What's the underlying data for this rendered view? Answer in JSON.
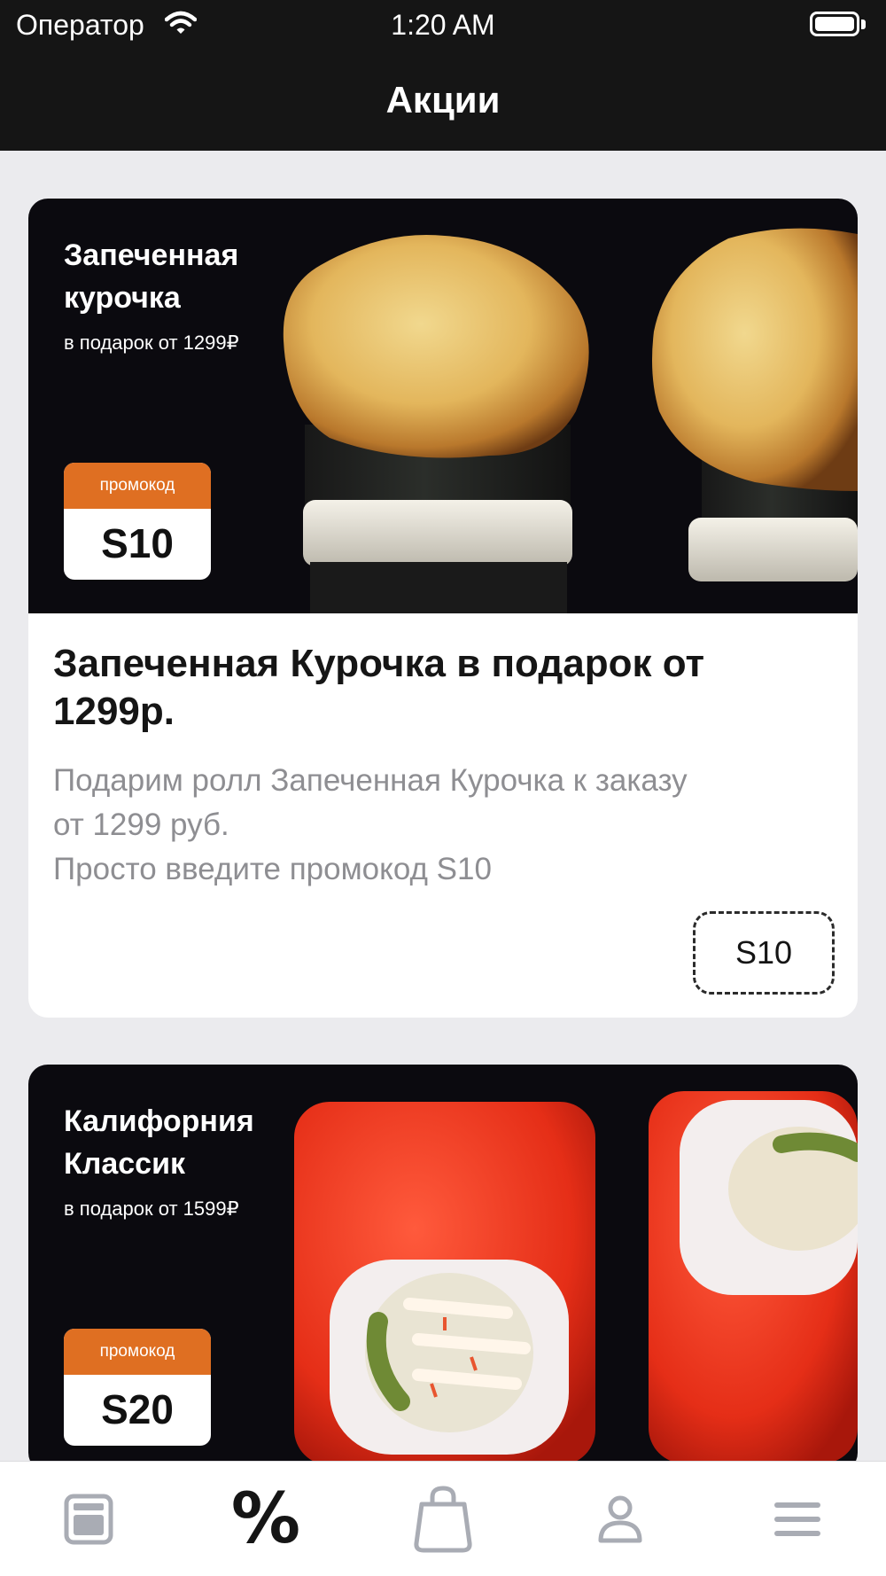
{
  "status_bar": {
    "carrier": "Оператор",
    "time": "1:20 AM"
  },
  "header": {
    "title": "Акции"
  },
  "promotions": [
    {
      "banner_title": "Запеченная\nкурочка",
      "banner_subtitle": "в подарок от 1299₽",
      "promo_label": "промокод",
      "promo_code": "S10",
      "title": "Запеченная Курочка в подарок от 1299р.",
      "description": "Подарим ролл Запеченная Курочка к заказу\nот 1299 руб.\nПросто введите промокод S10",
      "code_chip": "S10"
    },
    {
      "banner_title": "Калифорния\nКлассик",
      "banner_subtitle": "в подарок от 1599₽",
      "promo_label": "промокод",
      "promo_code": "S20"
    }
  ],
  "tab_bar": {
    "items": [
      {
        "icon": "menu-card-icon",
        "active": false
      },
      {
        "icon": "percent-icon",
        "active": true,
        "glyph": "%"
      },
      {
        "icon": "shopping-bag-icon",
        "active": false
      },
      {
        "icon": "profile-icon",
        "active": false
      },
      {
        "icon": "hamburger-menu-icon",
        "active": false
      }
    ]
  },
  "colors": {
    "accent": "#df6f22",
    "dark": "#151515",
    "inactive_icon": "#a9acb4",
    "muted_text": "#8e8e92"
  }
}
